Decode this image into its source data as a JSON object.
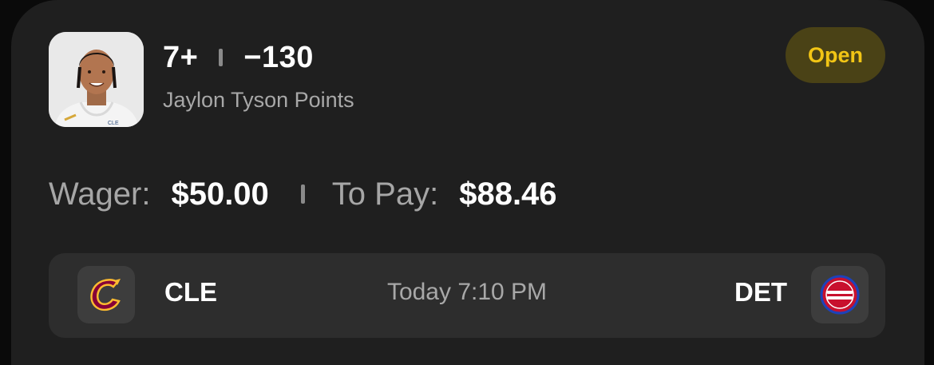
{
  "bet": {
    "line": "7+",
    "odds": "−130",
    "market": "Jaylon Tyson Points",
    "status": "Open"
  },
  "player": {
    "name": "Jaylon Tyson",
    "avatar_icon": "player-headshot"
  },
  "wager": {
    "wager_label": "Wager:",
    "wager_amount": "$50.00",
    "topay_label": "To Pay:",
    "topay_amount": "$88.46"
  },
  "game": {
    "away_abbr": "CLE",
    "away_logo": "cavaliers-logo-icon",
    "home_abbr": "DET",
    "home_logo": "pistons-logo-icon",
    "time": "Today 7:10 PM"
  },
  "colors": {
    "card_bg": "#1f1f1f",
    "badge_bg": "#4a4216",
    "badge_text": "#f2c515",
    "cavs_wine": "#860038",
    "cavs_gold": "#FDBB30",
    "pistons_red": "#C8102E",
    "pistons_blue": "#1D42BA"
  }
}
